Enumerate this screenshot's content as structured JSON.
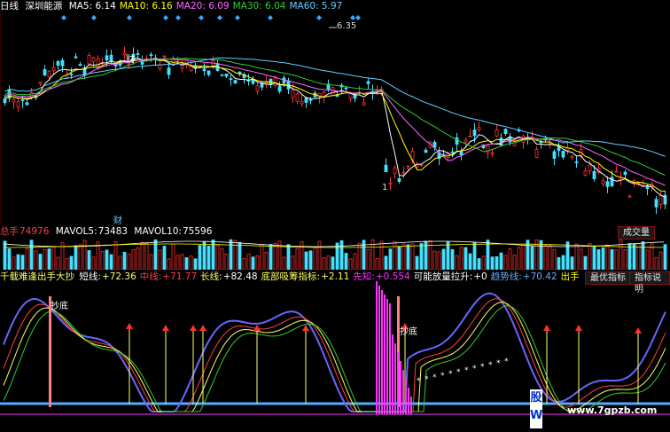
{
  "price": {
    "period": "日线",
    "stock": "深圳能源",
    "ma": [
      {
        "name": "MA5",
        "value": "6.14",
        "color": "#ffffff"
      },
      {
        "name": "MA10",
        "value": "6.16",
        "color": "#ffff00"
      },
      {
        "name": "MA20",
        "value": "6.09",
        "color": "#ff66ff"
      },
      {
        "name": "MA30",
        "value": "6.04",
        "color": "#33cc33"
      },
      {
        "name": "MA60",
        "value": "5.97",
        "color": "#66ccff"
      }
    ],
    "high_label": "6.35",
    "low_label": "1",
    "finance_marker": "财",
    "finance_marker2": "财"
  },
  "volume": {
    "total_label": "总手",
    "total_value": "74976",
    "mavol5_label": "MAVOL5:",
    "mavol5_value": "73483",
    "mavol10_label": "MAVOL10:",
    "mavol10_value": "75596",
    "button": "成交量"
  },
  "indicator": {
    "name": "千载难逢出手大抄",
    "items": [
      {
        "label": "短线:",
        "value": "+72.36",
        "color": "#ffffff",
        "vcolor": "#ffff66"
      },
      {
        "label": "中线:",
        "value": "+71.77",
        "color": "#ff4040",
        "vcolor": "#ff4040"
      },
      {
        "label": "长线:",
        "value": "+82.48",
        "color": "#ffff66",
        "vcolor": "#ffffff"
      },
      {
        "label": "底部吸筹指标:",
        "value": "+2.11",
        "color": "#ffff66",
        "vcolor": "#ffff66"
      },
      {
        "label": "先知:",
        "value": "+0.554",
        "color": "#ff33ff",
        "vcolor": "#ff33ff"
      },
      {
        "label": "可能放量拉升:",
        "value": "+0",
        "color": "#ffffff",
        "vcolor": "#ffffff"
      },
      {
        "label": "趋势线:",
        "value": "+70.42",
        "color": "#66aaff",
        "vcolor": "#66aaff"
      },
      {
        "label": "出手",
        "value": "",
        "color": "#ffff00",
        "vcolor": "#ffff00"
      }
    ],
    "buttons": [
      "最优指标",
      "指标说明"
    ],
    "annotation1": "抄底",
    "annotation2": "抄底"
  },
  "watermark": {
    "site": "www.7gpzb.com",
    "logo_chars": "股W"
  }
}
